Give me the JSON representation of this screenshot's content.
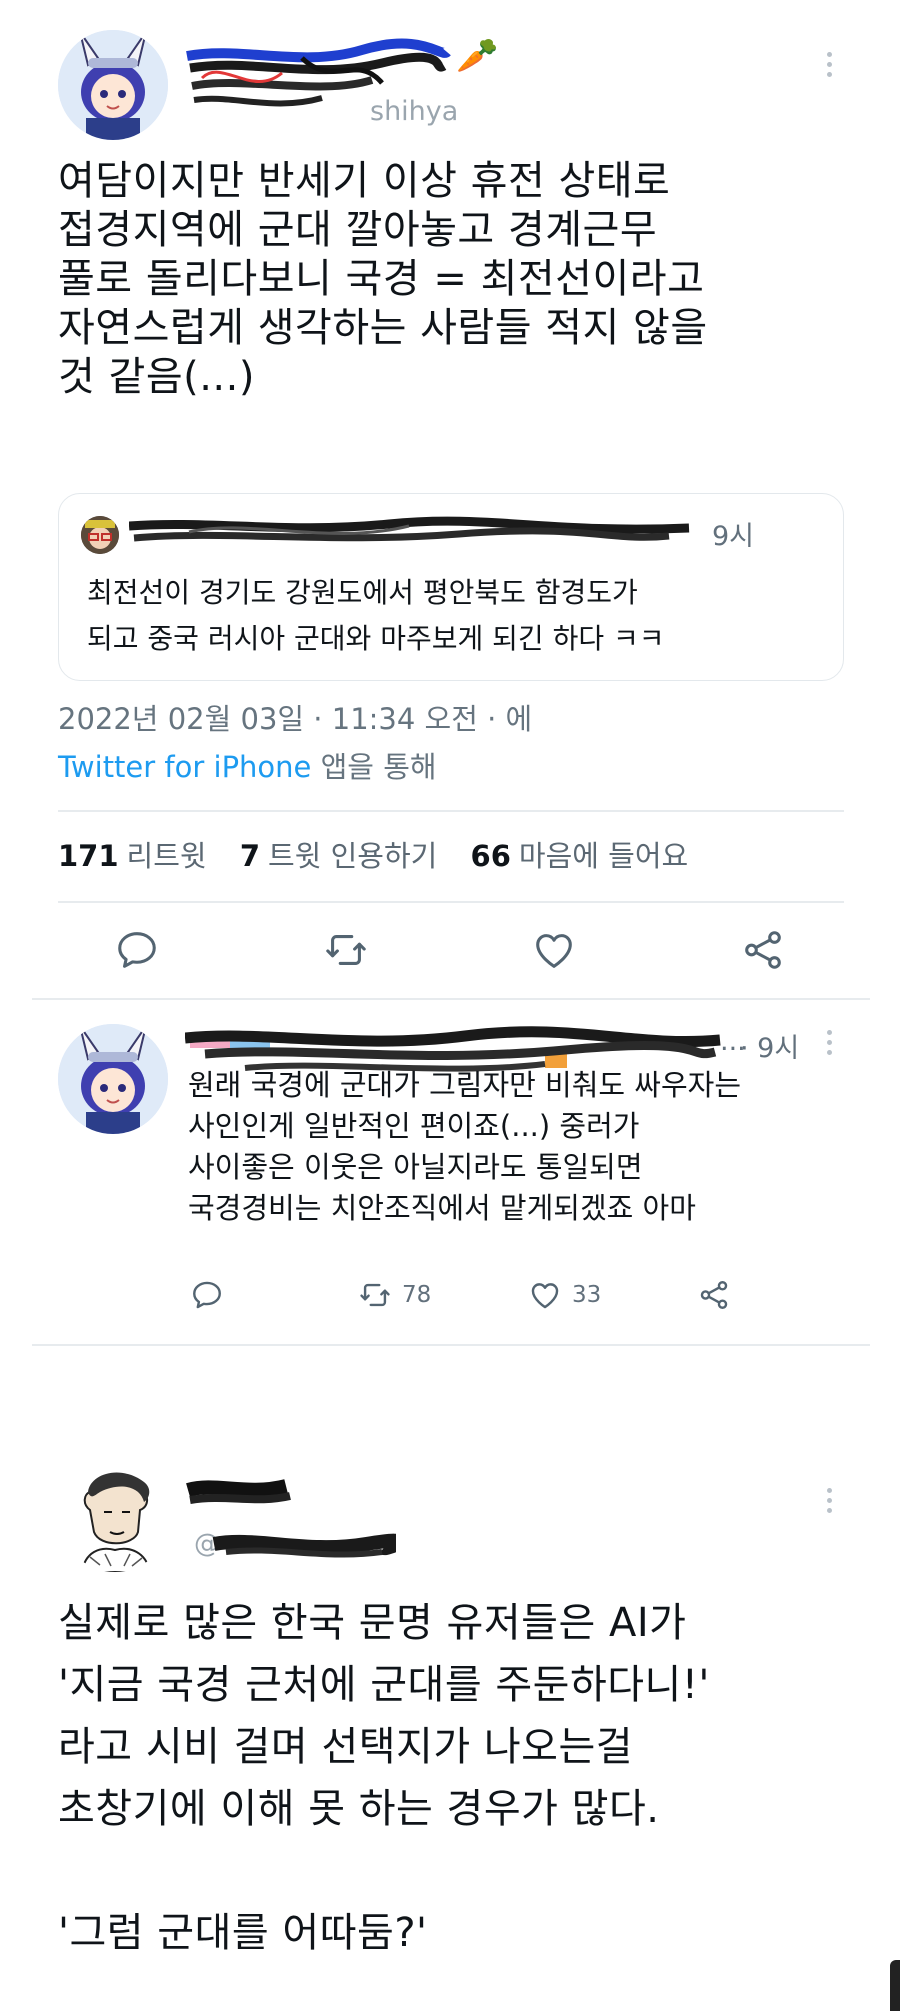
{
  "tweet1": {
    "name_censored": "",
    "handle_partial": "shihya",
    "name_emoji": "🥕",
    "body_lines": [
      "여담이지만 반세기 이상 휴전 상태로",
      "접경지역에 군대 깔아놓고 경계근무",
      "풀로 돌리다보니 국경 = 최전선이라고",
      "자연스럽게 생각하는 사람들 적지 않을",
      "것 같음(...)"
    ],
    "quote": {
      "time": "9시",
      "lines": [
        "최전선이 경기도 강원도에서 평안북도 함경도가",
        "되고 중국 러시아 군대와 마주보게 되긴 하다 ㅋㅋ"
      ]
    },
    "datetime": "2022년 02월 03일 · 11:34 오전 · 에",
    "client": "Twitter for iPhone",
    "client_suffix": " 앱을 통해",
    "stats": {
      "retweets": "171",
      "retweets_label": "리트윗",
      "quotes": "7",
      "quotes_label": "트윗 인용하기",
      "likes": "66",
      "likes_label": "마음에 들어요"
    },
    "actions": [
      "reply-icon",
      "retweet-icon",
      "like-icon",
      "share-icon"
    ]
  },
  "reply": {
    "time": "· 9시",
    "name_tail": "...",
    "lines": [
      "원래 국경에 군대가 그림자만 비춰도 싸우자는",
      "사인인게 일반적인 편이죠(...) 중러가",
      "사이좋은 이웃은 아닐지라도 통일되면",
      "국경경비는 치안조직에서 맡게되겠죠 아마"
    ],
    "retweet_count": "78",
    "like_count": "33"
  },
  "tweet2": {
    "body_lines": [
      "실제로 많은 한국 문명 유저들은 AI가",
      "'지금 국경 근처에 군대를 주둔하다니!'",
      "라고 시비 걸며 선택지가 나오는걸",
      "초창기에 이해 못 하는 경우가 많다.",
      "",
      "'그럼 군대를 어따둠?'"
    ]
  },
  "colors": {
    "link": "#1d9bf0",
    "text": "#0f1419",
    "muted": "#66747f",
    "border": "#e3e8ec"
  }
}
